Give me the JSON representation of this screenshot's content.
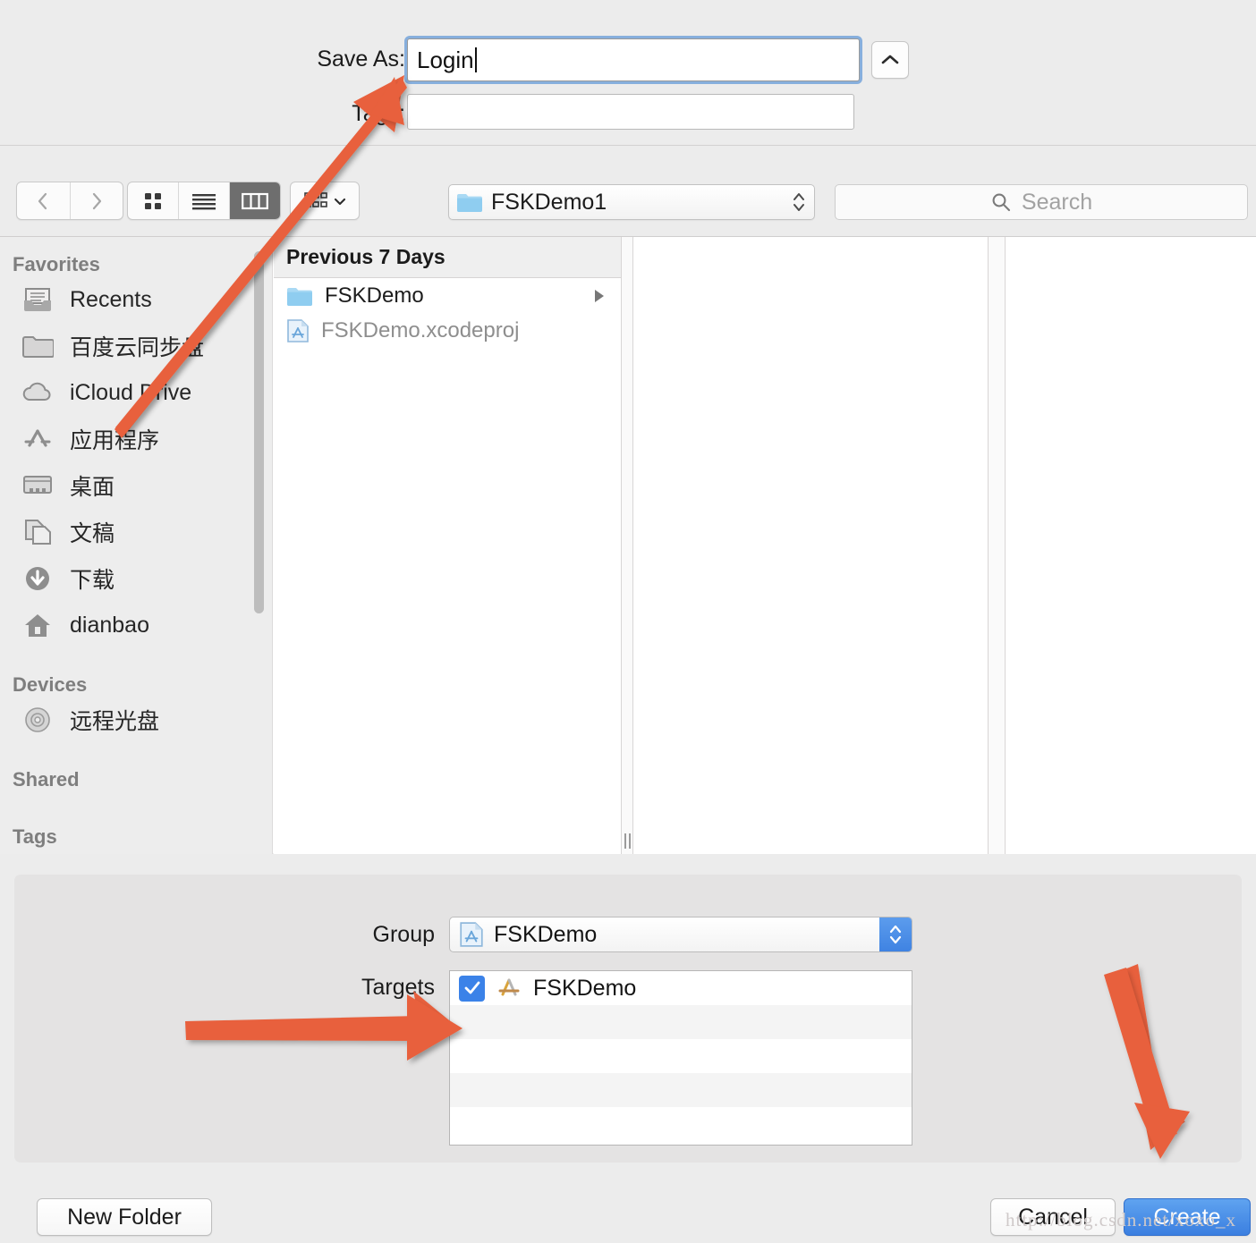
{
  "dialog": {
    "save_as_label": "Save As:",
    "save_as_value": "Login",
    "tags_label": "Tags:",
    "tags_value": "",
    "expand_button_icon": "chevron-up-icon"
  },
  "toolbar": {
    "back_icon": "chevron-left-icon",
    "forward_icon": "chevron-right-icon",
    "view_icon_label": "icon-view",
    "view_list_label": "list-view",
    "view_column_label": "column-view",
    "view_selected": "column-view",
    "arrange_label": "arrange-items",
    "path_popup_value": "FSKDemo1",
    "search_placeholder": "Search",
    "search_value": "",
    "search_icon": "search-icon"
  },
  "sidebar": {
    "sections": [
      {
        "header": "Favorites",
        "items": [
          {
            "label": "Recents",
            "icon": "recents-icon"
          },
          {
            "label": "百度云同步盘",
            "icon": "folder-icon"
          },
          {
            "label": "iCloud Drive",
            "icon": "cloud-icon"
          },
          {
            "label": "应用程序",
            "icon": "applications-icon"
          },
          {
            "label": "桌面",
            "icon": "desktop-icon"
          },
          {
            "label": "文稿",
            "icon": "documents-icon"
          },
          {
            "label": "下载",
            "icon": "downloads-icon"
          },
          {
            "label": "dianbao",
            "icon": "home-icon"
          }
        ]
      },
      {
        "header": "Devices",
        "items": [
          {
            "label": "远程光盘",
            "icon": "disc-icon"
          }
        ]
      },
      {
        "header": "Shared",
        "items": []
      },
      {
        "header": "Tags",
        "items": []
      }
    ]
  },
  "browser": {
    "column_header": "Previous 7 Days",
    "files": [
      {
        "name": "FSKDemo",
        "icon": "folder-icon",
        "dimmed": false,
        "has_disclosure": true
      },
      {
        "name": "FSKDemo.xcodeproj",
        "icon": "xcodeproj-icon",
        "dimmed": true,
        "has_disclosure": false
      }
    ]
  },
  "accessory": {
    "group_label": "Group",
    "group_value": "FSKDemo",
    "group_icon": "xcodeproj-icon",
    "targets_label": "Targets",
    "targets": [
      {
        "name": "FSKDemo",
        "checked": true,
        "icon": "xcode-app-icon"
      }
    ]
  },
  "buttons": {
    "new_folder": "New Folder",
    "cancel": "Cancel",
    "create": "Create"
  },
  "watermark": "http://blog.csdn.net/xoxo_x",
  "colors": {
    "accent_blue": "#3b7fe0",
    "focus_ring": "#76a5db",
    "annotation_orange": "#e8603c",
    "window_bg": "#ececec",
    "sidebar_bg": "#ededed"
  }
}
